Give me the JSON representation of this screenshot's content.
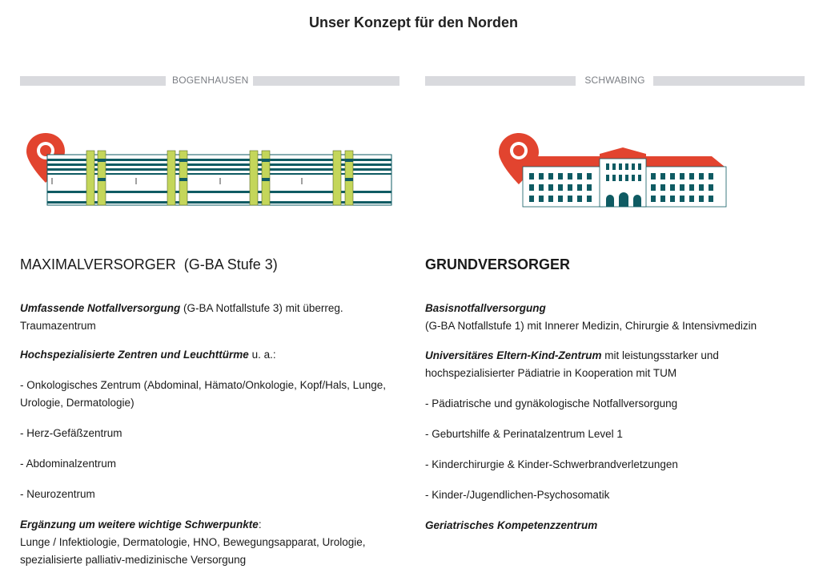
{
  "page": {
    "title": "Unser Konzept für den Norden"
  },
  "left": {
    "label": "BOGENHAUSEN",
    "heading_main": "MAXIMALVERSORGER",
    "heading_sub": "(G-BA Stufe 3)",
    "illustration_icon": "modern-hospital-building-icon",
    "items": [
      {
        "em": "Umfassende Notfallversorgung",
        "text": " (G-BA Notfallstufe 3) mit überreg. Traumazentrum"
      },
      {
        "em": "Hochspezialisierte Zentren und Leuchttürme",
        "text": " u. a.:"
      },
      {
        "em": "",
        "text": "- Onkologisches Zentrum (Abdominal, Hämato/Onkologie, Kopf/Hals, Lunge, Urologie, Dermatologie)"
      },
      {
        "em": "",
        "text": "- Herz-Gefäßzentrum"
      },
      {
        "em": "",
        "text": "- Abdominalzentrum"
      },
      {
        "em": "",
        "text": "- Neurozentrum"
      },
      {
        "em": "Ergänzung um weitere wichtige Schwerpunkte",
        "text": ":\nLunge / Infektiologie, Dermatologie, HNO, Bewegungsapparat, Urologie, spezialisierte palliativ-medizinische Versorgung"
      }
    ]
  },
  "right": {
    "label": "SCHWABING",
    "heading_main": "GRUNDVERSORGER",
    "heading_sub": "",
    "illustration_icon": "historic-hospital-building-icon",
    "items": [
      {
        "em": "Basisnotfallversorgung",
        "text": "\n(G-BA Notfallstufe 1)  mit Innerer Medizin, Chirurgie & Intensivmedizin"
      },
      {
        "em": "Universitäres Eltern-Kind-Zentrum",
        "text": " mit leistungsstarker und hochspezialisierter Pädiatrie in Kooperation mit TUM"
      },
      {
        "em": "",
        "text": "- Pädiatrische und gynäkologische Notfallversorgung"
      },
      {
        "em": "",
        "text": "- Geburtshilfe & Perinatalzentrum Level 1"
      },
      {
        "em": "",
        "text": "- Kinderchirurgie & Kinder-Schwerbrandverletzungen"
      },
      {
        "em": "",
        "text": "-  Kinder-/Jugendlichen-Psychosomatik"
      },
      {
        "em": "Geriatrisches Kompetenzzentrum",
        "text": ""
      }
    ]
  },
  "colors": {
    "accent_red": "#e2442f",
    "teal": "#0f5b63",
    "lime": "#c4d65a",
    "divider": "#d9dade"
  }
}
